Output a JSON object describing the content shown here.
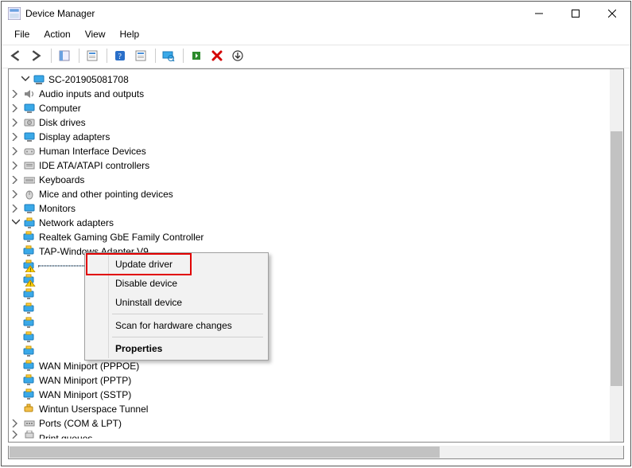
{
  "window": {
    "title": "Device Manager"
  },
  "menubar": {
    "items": [
      "File",
      "Action",
      "View",
      "Help"
    ]
  },
  "tree": {
    "root": "SC-201905081708",
    "categories": [
      {
        "label": "Audio inputs and outputs",
        "icon": "speaker"
      },
      {
        "label": "Computer",
        "icon": "monitor"
      },
      {
        "label": "Disk drives",
        "icon": "drive"
      },
      {
        "label": "Display adapters",
        "icon": "monitor"
      },
      {
        "label": "Human Interface Devices",
        "icon": "hid"
      },
      {
        "label": "IDE ATA/ATAPI controllers",
        "icon": "ide"
      },
      {
        "label": "Keyboards",
        "icon": "keyboard"
      },
      {
        "label": "Mice and other pointing devices",
        "icon": "mouse"
      },
      {
        "label": "Monitors",
        "icon": "monitor"
      }
    ],
    "network": {
      "label": "Network adapters",
      "children": [
        {
          "label": "Realtek Gaming GbE Family Controller",
          "warn": false
        },
        {
          "label": "TAP-Windows Adapter V9",
          "warn": false
        },
        {
          "label": "",
          "warn": true,
          "obscured": true
        },
        {
          "label": "",
          "warn": true,
          "obscured": true
        },
        {
          "label": "",
          "warn": false,
          "obscured": true
        },
        {
          "label": "",
          "warn": false,
          "obscured": true
        },
        {
          "label": "",
          "warn": false,
          "obscured": true
        },
        {
          "label": "",
          "warn": false,
          "obscured": true
        },
        {
          "label": "",
          "warn": false,
          "obscured": true
        },
        {
          "label": "WAN Miniport (PPPOE)",
          "warn": false,
          "clipped": true
        },
        {
          "label": "WAN Miniport (PPTP)",
          "warn": false
        },
        {
          "label": "WAN Miniport (SSTP)",
          "warn": false
        },
        {
          "label": "Wintun Userspace Tunnel",
          "warn": false
        }
      ]
    },
    "after": [
      {
        "label": "Ports (COM & LPT)",
        "icon": "port"
      },
      {
        "label": "Print queues",
        "icon": "printer",
        "cut": true
      }
    ]
  },
  "context_menu": {
    "items": [
      {
        "label": "Update driver",
        "highlight": true
      },
      {
        "label": "Disable device"
      },
      {
        "label": "Uninstall device"
      },
      {
        "sep": true
      },
      {
        "label": "Scan for hardware changes"
      },
      {
        "sep": true
      },
      {
        "label": "Properties",
        "bold": true
      }
    ]
  }
}
